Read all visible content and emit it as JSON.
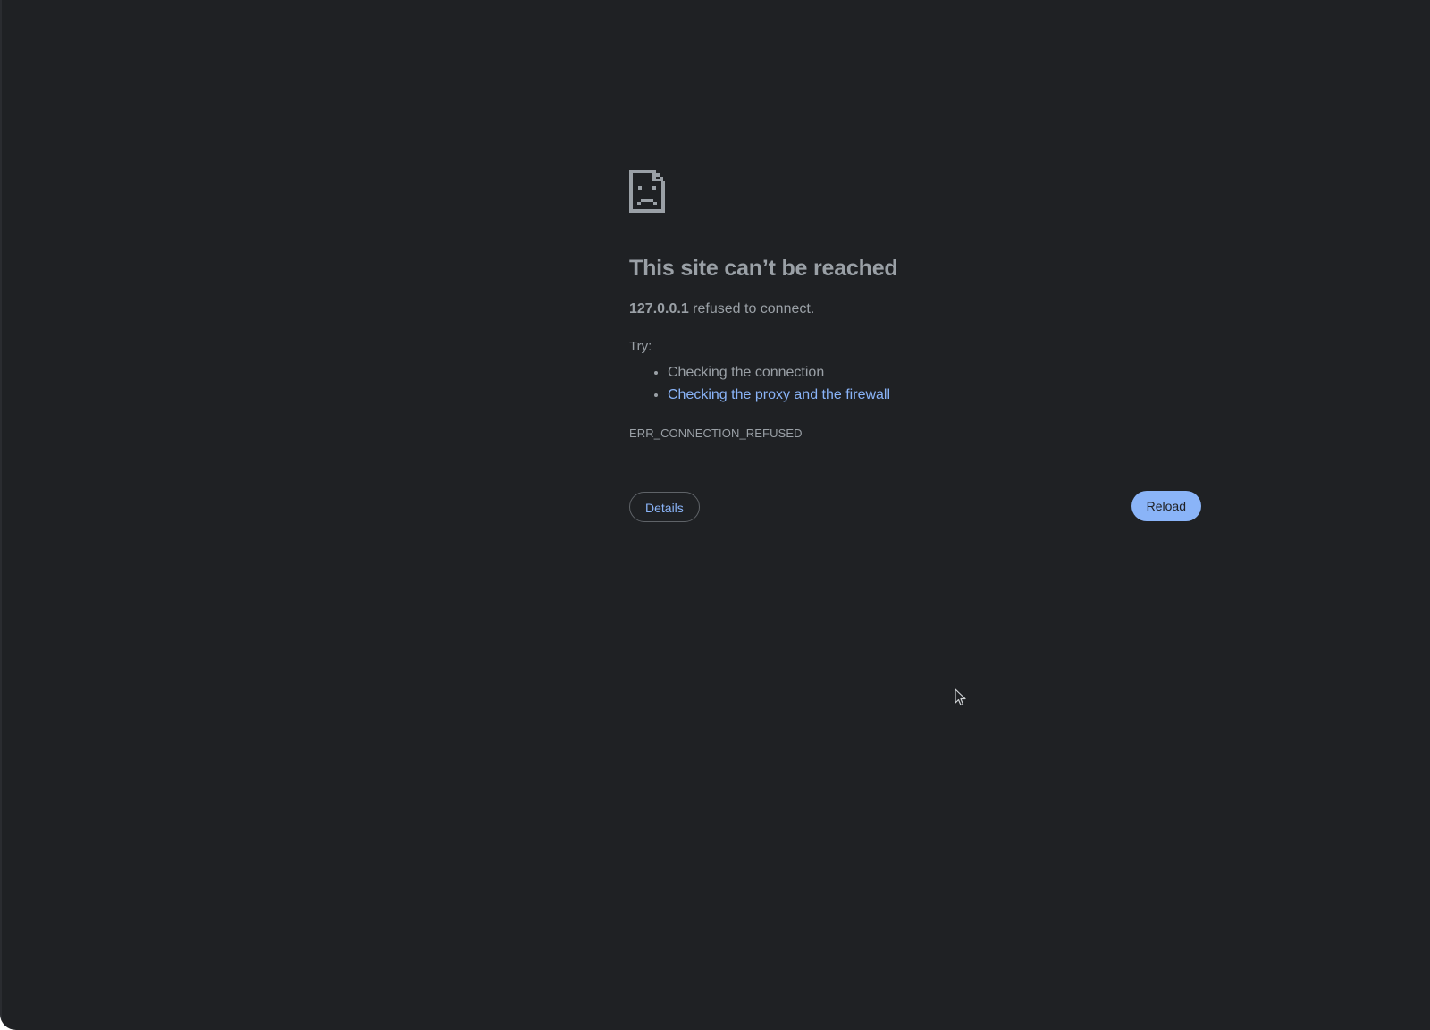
{
  "page": {
    "background_color": "#1f2124",
    "text_color": "#9aa0a6",
    "link_color": "#8ab4f8"
  },
  "error": {
    "icon": "sad-page-icon",
    "title": "This site can’t be reached",
    "host": "127.0.0.1",
    "summary_rest": " refused to connect.",
    "try_label": "Try:",
    "suggestions": [
      {
        "label": "Checking the connection",
        "is_link": false
      },
      {
        "label": "Checking the proxy and the firewall",
        "is_link": true
      }
    ],
    "code": "ERR_CONNECTION_REFUSED"
  },
  "buttons": {
    "details_label": "Details",
    "reload_label": "Reload"
  },
  "cursor": {
    "icon": "mouse-pointer-icon"
  }
}
